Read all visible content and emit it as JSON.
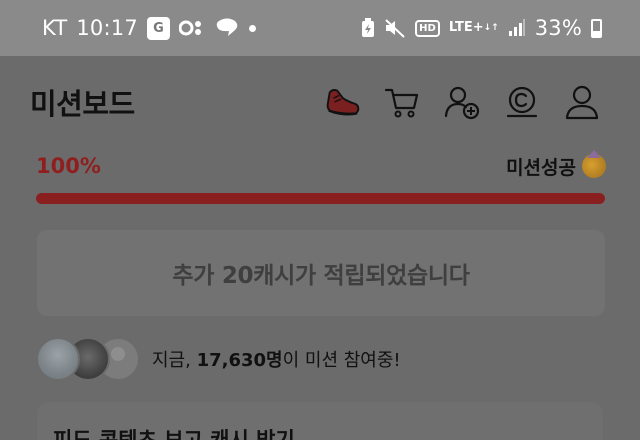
{
  "status_bar": {
    "carrier": "KT",
    "time": "10:17",
    "hd_label": "HD",
    "network": "LTE+",
    "battery_percent": "33%"
  },
  "header": {
    "title": "미션보드",
    "icons": [
      "shoe-icon",
      "cart-icon",
      "add-friend-icon",
      "cash-coin-icon",
      "profile-icon"
    ]
  },
  "progress": {
    "percent_label": "100%",
    "value": 1.0,
    "status_label": "미션성공",
    "bar_color": "#8a1f1f"
  },
  "reward_banner": {
    "text": "추가 20캐시가 적립되었습니다"
  },
  "participants": {
    "prefix": "지금, ",
    "count": "17,630명",
    "suffix": "이 미션 참여중!"
  },
  "feed_card": {
    "title": "피드 콘텐츠 보고 캐시 받기"
  }
}
